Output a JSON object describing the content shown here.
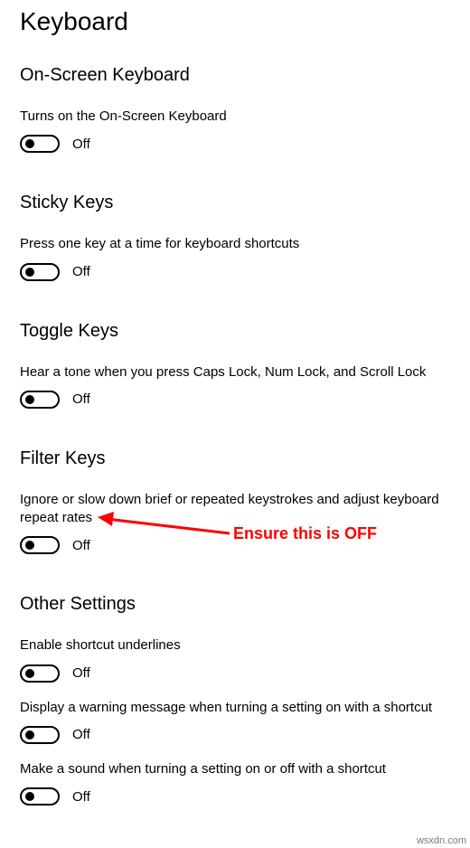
{
  "page_title": "Keyboard",
  "sections": {
    "osk": {
      "title": "On-Screen Keyboard",
      "desc": "Turns on the On-Screen Keyboard",
      "state_label": "Off",
      "state": false
    },
    "sticky": {
      "title": "Sticky Keys",
      "desc": "Press one key at a time for keyboard shortcuts",
      "state_label": "Off",
      "state": false
    },
    "toggle": {
      "title": "Toggle Keys",
      "desc": "Hear a tone when you press Caps Lock, Num Lock, and Scroll Lock",
      "state_label": "Off",
      "state": false
    },
    "filter": {
      "title": "Filter Keys",
      "desc": "Ignore or slow down brief or repeated keystrokes and adjust keyboard repeat rates",
      "state_label": "Off",
      "state": false
    },
    "other": {
      "title": "Other Settings",
      "item1_desc": "Enable shortcut underlines",
      "item1_state_label": "Off",
      "item2_desc": "Display a warning message when turning a setting on with a shortcut",
      "item2_state_label": "Off",
      "item3_desc": "Make a sound when turning a setting on or off with a shortcut",
      "item3_state_label": "Off"
    }
  },
  "annotation": {
    "text": "Ensure this is OFF",
    "color": "#ff0000"
  },
  "watermark": "wsxdn.com"
}
